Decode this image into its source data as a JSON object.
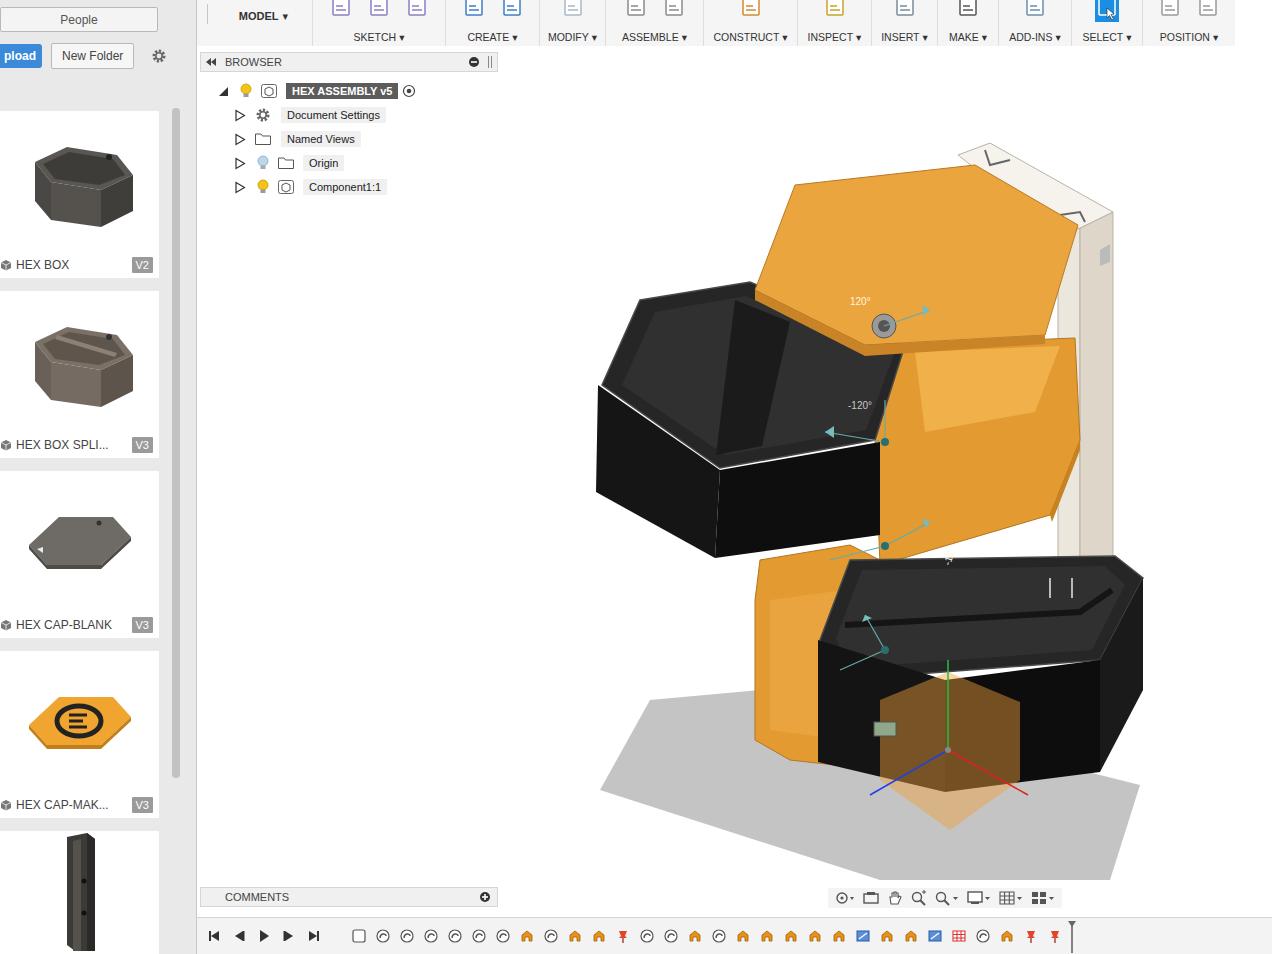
{
  "data_panel": {
    "people_button": "People",
    "upload_button": "pload",
    "new_folder_button": "New Folder",
    "cards": [
      {
        "name": "HEX BOX",
        "version": "V2",
        "kind": "box"
      },
      {
        "name": "HEX BOX SPLI...",
        "version": "V3",
        "kind": "split"
      },
      {
        "name": "HEX CAP-BLANK",
        "version": "V3",
        "kind": "cap"
      },
      {
        "name": "HEX CAP-MAK...",
        "version": "V3",
        "kind": "logo"
      }
    ]
  },
  "toolbar": {
    "workspace": "MODEL",
    "dropdown_glyph": "▾",
    "menus": [
      {
        "label": "SKETCH",
        "active": false
      },
      {
        "label": "CREATE",
        "active": false
      },
      {
        "label": "MODIFY",
        "active": false
      },
      {
        "label": "ASSEMBLE",
        "active": false
      },
      {
        "label": "CONSTRUCT",
        "active": false
      },
      {
        "label": "INSPECT",
        "active": false
      },
      {
        "label": "INSERT",
        "active": false
      },
      {
        "label": "MAKE",
        "active": false
      },
      {
        "label": "ADD-INS",
        "active": false
      },
      {
        "label": "SELECT",
        "active": true
      },
      {
        "label": "POSITION",
        "active": false
      }
    ]
  },
  "browser": {
    "title": "BROWSER",
    "items": [
      {
        "label": "HEX ASSEMBLY v5",
        "kind": "root",
        "expanded": true,
        "selected": true,
        "visible": true
      },
      {
        "label": "Document Settings",
        "kind": "settings",
        "expanded": false,
        "selected": false
      },
      {
        "label": "Named Views",
        "kind": "folder",
        "expanded": false,
        "selected": false
      },
      {
        "label": "Origin",
        "kind": "origin",
        "expanded": false,
        "selected": false,
        "visible": false
      },
      {
        "label": "Component1:1",
        "kind": "component",
        "expanded": false,
        "selected": false,
        "visible": true
      }
    ]
  },
  "viewport": {
    "labels": [
      {
        "text": "120°"
      },
      {
        "text": "-120°"
      },
      {
        "text": "-12"
      }
    ]
  },
  "comments": {
    "title": "COMMENTS"
  },
  "timeline": {
    "features": [
      {
        "kind": "sketch"
      },
      {
        "kind": "joint"
      },
      {
        "kind": "joint"
      },
      {
        "kind": "joint"
      },
      {
        "kind": "joint"
      },
      {
        "kind": "joint"
      },
      {
        "kind": "joint"
      },
      {
        "kind": "move"
      },
      {
        "kind": "joint"
      },
      {
        "kind": "move"
      },
      {
        "kind": "move"
      },
      {
        "kind": "pin"
      },
      {
        "kind": "joint"
      },
      {
        "kind": "joint"
      },
      {
        "kind": "move"
      },
      {
        "kind": "joint"
      },
      {
        "kind": "move"
      },
      {
        "kind": "move"
      },
      {
        "kind": "move"
      },
      {
        "kind": "move"
      },
      {
        "kind": "move"
      },
      {
        "kind": "component"
      },
      {
        "kind": "move"
      },
      {
        "kind": "move"
      },
      {
        "kind": "component"
      },
      {
        "kind": "table"
      },
      {
        "kind": "joint"
      },
      {
        "kind": "move"
      },
      {
        "kind": "pin"
      },
      {
        "kind": "pin"
      }
    ]
  }
}
